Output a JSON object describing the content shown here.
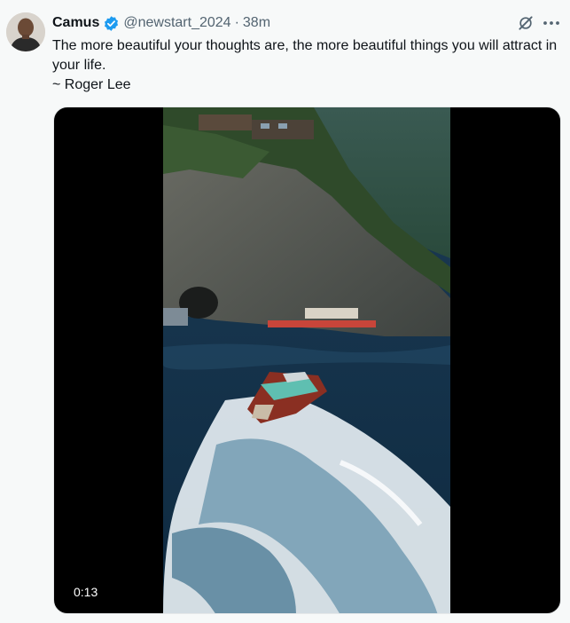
{
  "tweet": {
    "author_name": "Camus",
    "handle": "@newstart_2024",
    "separator": "·",
    "time_ago": "38m",
    "text_lines": [
      "The more beautiful your thoughts are, the more beautiful things you will attract in your life.",
      "~ Roger Lee"
    ],
    "video": {
      "duration": "0:13"
    }
  },
  "icons": {
    "verified": "verified-badge-icon",
    "grok": "grok-icon",
    "more": "more-options-icon"
  },
  "colors": {
    "background": "#f7f9f9",
    "text": "#0f1419",
    "secondary_text": "#536471",
    "verified_blue": "#1d9bf0"
  }
}
